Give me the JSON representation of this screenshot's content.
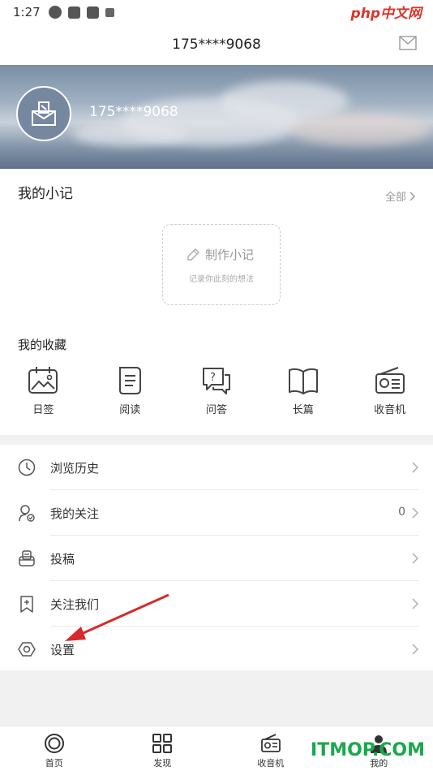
{
  "status_bar": {
    "time": "1:27"
  },
  "watermark_top": "php中文网",
  "header": {
    "title": "175****9068",
    "mail_icon": "mail-icon"
  },
  "profile": {
    "username": "175****9068",
    "avatar_icon": "avatar-box-icon"
  },
  "notes": {
    "title": "我的小记",
    "all_label": "全部",
    "make_label": "制作小记",
    "make_sub": "记录你此刻的想法"
  },
  "favorites": {
    "title": "我的收藏",
    "items": [
      {
        "label": "日签",
        "icon": "calendar-sign-icon"
      },
      {
        "label": "阅读",
        "icon": "document-icon"
      },
      {
        "label": "问答",
        "icon": "qa-bubble-icon"
      },
      {
        "label": "长篇",
        "icon": "book-icon"
      },
      {
        "label": "收音机",
        "icon": "radio-icon"
      }
    ]
  },
  "menu": [
    {
      "label": "浏览历史",
      "icon": "clock-icon",
      "count": ""
    },
    {
      "label": "我的关注",
      "icon": "user-follow-icon",
      "count": "0"
    },
    {
      "label": "投稿",
      "icon": "submit-tray-icon",
      "count": ""
    },
    {
      "label": "关注我们",
      "icon": "bookmark-plus-icon",
      "count": ""
    },
    {
      "label": "设置",
      "icon": "hexagon-settings-icon",
      "count": ""
    }
  ],
  "tabbar": [
    {
      "label": "首页",
      "icon": "home-circle-icon"
    },
    {
      "label": "发现",
      "icon": "grid-icon"
    },
    {
      "label": "收音机",
      "icon": "radio-icon"
    },
    {
      "label": "我的",
      "icon": "person-icon"
    }
  ],
  "watermark_bottom": "ITMOP.COM",
  "colors": {
    "accent_red": "#d62b2b",
    "watermark_green": "#1aa84c"
  }
}
